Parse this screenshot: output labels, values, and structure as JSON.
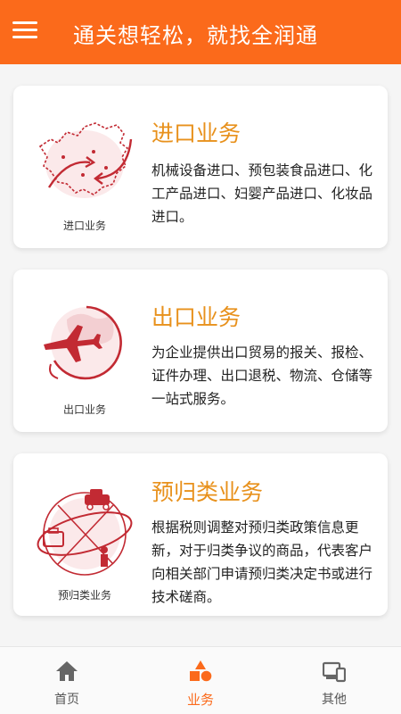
{
  "header": {
    "title": "通关想轻松，就找全润通",
    "menu_icon": "hamburger-menu-icon"
  },
  "cards": [
    {
      "title": "进口业务",
      "caption": "进口业务",
      "description": "机械设备进口、预包装食品进口、化工产品进口、妇婴产品进口、化妆品进口。",
      "icon": "china-map-import-icon"
    },
    {
      "title": "出口业务",
      "caption": "出口业务",
      "description": "为企业提供出口贸易的报关、报检、证件办理、出口退税、物流、仓储等一站式服务。",
      "icon": "globe-airplane-export-icon"
    },
    {
      "title": "预归类业务",
      "caption": "预归类业务",
      "description": "根据税则调整对预归类政策信息更新，对于归类争议的商品，代表客户向相关部门申请预归类决定书或进行技术磋商。",
      "icon": "globe-orbit-preclassification-icon"
    }
  ],
  "nav": [
    {
      "label": "首页",
      "icon": "home-icon",
      "active": false
    },
    {
      "label": "业务",
      "icon": "shapes-icon",
      "active": true
    },
    {
      "label": "其他",
      "icon": "devices-icon",
      "active": false
    }
  ],
  "colors": {
    "accent": "#fb6a1b",
    "card_title": "#e8911c",
    "illustration": "#c22a33",
    "nav_inactive": "#555555"
  }
}
